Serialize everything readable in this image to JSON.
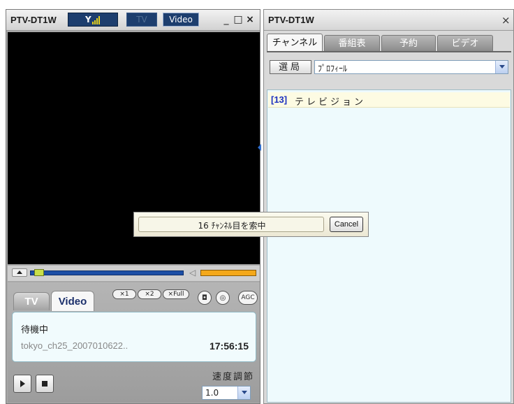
{
  "player": {
    "title": "PTV-DT1W",
    "signal_icon": "antenna-signal-icon",
    "mode_tv": "TV",
    "mode_video": "Video",
    "window_controls": [
      "_",
      "□",
      "×"
    ],
    "tabs": {
      "tv": "TV",
      "video": "Video"
    },
    "speed_buttons": [
      "×1",
      "×2",
      "×Full"
    ],
    "capture_icon": "camera-icon",
    "settings_icon": "disc-icon",
    "agc_label": "AGC",
    "status": "待機中",
    "file": "tokyo_ch25_2007010622..",
    "time": "17:56:15",
    "speed_label": "速度調節",
    "speed_value": "1.0"
  },
  "epg": {
    "title": "PTV-DT1W",
    "close": "×",
    "tabs": [
      "チャンネル",
      "番組表",
      "予約",
      "ビデオ"
    ],
    "station_button": "選局",
    "profile_value": "ﾌﾟﾛﾌｨｰﾙ",
    "channels": [
      {
        "number": "[13]",
        "name": "テレビジョン"
      }
    ]
  },
  "dialog": {
    "message": "16 ﾁｬﾝﾈﾙ目を索中",
    "cancel": "Cancel"
  },
  "colors": {
    "accent_blue": "#1d3e6e",
    "seek_blue": "#1d4fa6",
    "volume_orange": "#f4a81a",
    "list_bg": "#eefafd"
  }
}
